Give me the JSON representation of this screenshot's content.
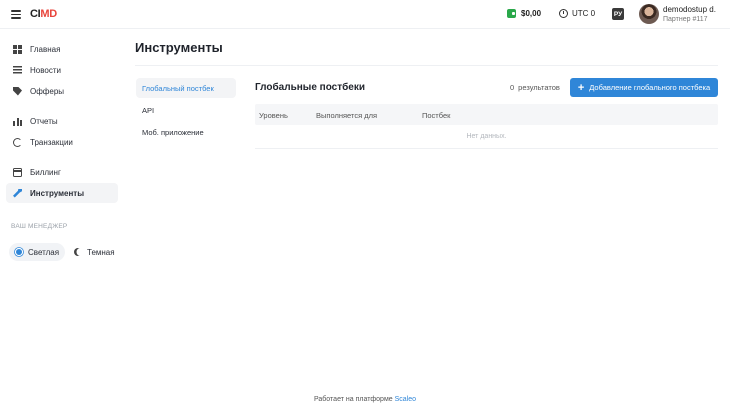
{
  "header": {
    "logo": "CIMD",
    "balance": "$0,00",
    "timezone": "UTC 0",
    "language": "РУ",
    "user_name": "demodostup d.",
    "user_role": "Партнер #117"
  },
  "sidebar": {
    "items": [
      {
        "label": "Главная",
        "icon": "dashboard-icon"
      },
      {
        "label": "Новости",
        "icon": "news-icon"
      },
      {
        "label": "Офферы",
        "icon": "tag-icon"
      },
      {
        "label": "Отчеты",
        "icon": "bar-chart-icon"
      },
      {
        "label": "Транзакции",
        "icon": "transactions-icon"
      },
      {
        "label": "Биллинг",
        "icon": "credit-card-icon"
      },
      {
        "label": "Инструменты",
        "icon": "wrench-icon",
        "active": true
      }
    ],
    "manager_label": "ВАШ МЕНЕДЖЕР",
    "theme_light": "Светлая",
    "theme_dark": "Темная"
  },
  "main": {
    "title": "Инструменты",
    "subnav": [
      {
        "label": "Глобальный постбек",
        "active": true
      },
      {
        "label": "API"
      },
      {
        "label": "Моб. приложение"
      }
    ],
    "section_title": "Глобальные постбеки",
    "results_count": "0",
    "results_label": "результатов",
    "add_button": "Добавление глобального постбека",
    "table": {
      "columns": [
        "Уровень",
        "Выполняется для",
        "Постбек"
      ],
      "empty_text": "Нет данных."
    }
  },
  "footer": {
    "text": "Работает на платформе",
    "link": "Scaleo"
  },
  "colors": {
    "accent": "#2f86d8",
    "wallet": "#2aa84a",
    "logo_highlight": "#e8453c"
  }
}
